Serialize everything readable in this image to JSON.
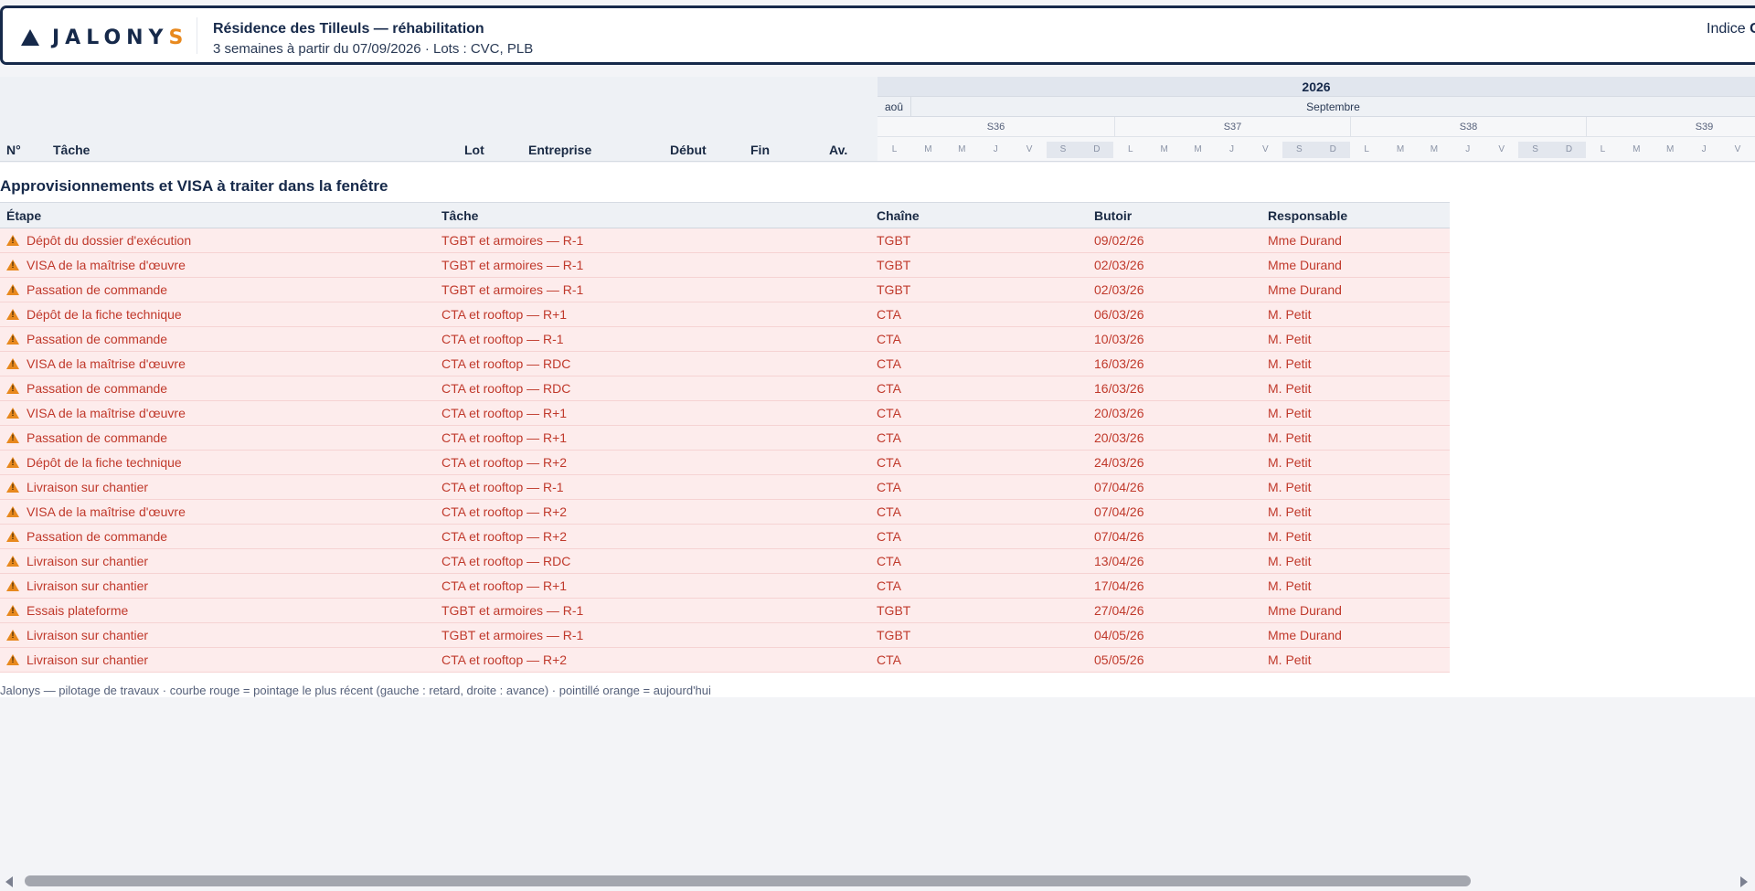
{
  "app": {
    "logo_main": "JALONY",
    "logo_accent": "S",
    "project_title": "Résidence des Tilleuls — réhabilitation",
    "project_subtitle": "3 semaines à partir du 07/09/2026 · Lots : CVC, PLB",
    "revision_label": "Indice",
    "revision_value": "C"
  },
  "colors": {
    "brand_navy": "#16294a",
    "brand_orange": "#e8891e",
    "alert_text": "#c0392b",
    "alert_row_bg": "#fdecec"
  },
  "grid": {
    "columns": [
      {
        "key": "num",
        "label": "N°"
      },
      {
        "key": "task",
        "label": "Tâche"
      },
      {
        "key": "lot",
        "label": "Lot"
      },
      {
        "key": "company",
        "label": "Entreprise"
      },
      {
        "key": "start",
        "label": "Début"
      },
      {
        "key": "end",
        "label": "Fin"
      },
      {
        "key": "progress",
        "label": "Av."
      }
    ]
  },
  "timeline": {
    "year": "2026",
    "months": [
      "aoû",
      "Septembre"
    ],
    "weeks": [
      "S36",
      "S37",
      "S38",
      "S39"
    ],
    "days": [
      "L",
      "M",
      "M",
      "J",
      "V",
      "S",
      "D",
      "L",
      "M",
      "M",
      "J",
      "V",
      "S",
      "D",
      "L",
      "M",
      "M",
      "J",
      "V",
      "S",
      "D",
      "L",
      "M",
      "M",
      "J",
      "V"
    ]
  },
  "procurement": {
    "title": "Approvisionnements et VISA à traiter dans la fenêtre",
    "columns": [
      "Étape",
      "Tâche",
      "Chaîne",
      "Butoir",
      "Responsable"
    ],
    "rows": [
      {
        "step": "Dépôt du dossier d'exécution",
        "task": "TGBT et armoires — R-1",
        "chain": "TGBT",
        "deadline": "09/02/26",
        "owner": "Mme Durand"
      },
      {
        "step": "VISA de la maîtrise d'œuvre",
        "task": "TGBT et armoires — R-1",
        "chain": "TGBT",
        "deadline": "02/03/26",
        "owner": "Mme Durand"
      },
      {
        "step": "Passation de commande",
        "task": "TGBT et armoires — R-1",
        "chain": "TGBT",
        "deadline": "02/03/26",
        "owner": "Mme Durand"
      },
      {
        "step": "Dépôt de la fiche technique",
        "task": "CTA et rooftop — R+1",
        "chain": "CTA",
        "deadline": "06/03/26",
        "owner": "M. Petit"
      },
      {
        "step": "Passation de commande",
        "task": "CTA et rooftop — R-1",
        "chain": "CTA",
        "deadline": "10/03/26",
        "owner": "M. Petit"
      },
      {
        "step": "VISA de la maîtrise d'œuvre",
        "task": "CTA et rooftop — RDC",
        "chain": "CTA",
        "deadline": "16/03/26",
        "owner": "M. Petit"
      },
      {
        "step": "Passation de commande",
        "task": "CTA et rooftop — RDC",
        "chain": "CTA",
        "deadline": "16/03/26",
        "owner": "M. Petit"
      },
      {
        "step": "VISA de la maîtrise d'œuvre",
        "task": "CTA et rooftop — R+1",
        "chain": "CTA",
        "deadline": "20/03/26",
        "owner": "M. Petit"
      },
      {
        "step": "Passation de commande",
        "task": "CTA et rooftop — R+1",
        "chain": "CTA",
        "deadline": "20/03/26",
        "owner": "M. Petit"
      },
      {
        "step": "Dépôt de la fiche technique",
        "task": "CTA et rooftop — R+2",
        "chain": "CTA",
        "deadline": "24/03/26",
        "owner": "M. Petit"
      },
      {
        "step": "Livraison sur chantier",
        "task": "CTA et rooftop — R-1",
        "chain": "CTA",
        "deadline": "07/04/26",
        "owner": "M. Petit"
      },
      {
        "step": "VISA de la maîtrise d'œuvre",
        "task": "CTA et rooftop — R+2",
        "chain": "CTA",
        "deadline": "07/04/26",
        "owner": "M. Petit"
      },
      {
        "step": "Passation de commande",
        "task": "CTA et rooftop — R+2",
        "chain": "CTA",
        "deadline": "07/04/26",
        "owner": "M. Petit"
      },
      {
        "step": "Livraison sur chantier",
        "task": "CTA et rooftop — RDC",
        "chain": "CTA",
        "deadline": "13/04/26",
        "owner": "M. Petit"
      },
      {
        "step": "Livraison sur chantier",
        "task": "CTA et rooftop — R+1",
        "chain": "CTA",
        "deadline": "17/04/26",
        "owner": "M. Petit"
      },
      {
        "step": "Essais plateforme",
        "task": "TGBT et armoires — R-1",
        "chain": "TGBT",
        "deadline": "27/04/26",
        "owner": "Mme Durand"
      },
      {
        "step": "Livraison sur chantier",
        "task": "TGBT et armoires — R-1",
        "chain": "TGBT",
        "deadline": "04/05/26",
        "owner": "Mme Durand"
      },
      {
        "step": "Livraison sur chantier",
        "task": "CTA et rooftop — R+2",
        "chain": "CTA",
        "deadline": "05/05/26",
        "owner": "M. Petit"
      }
    ]
  },
  "footer": {
    "note": "Jalonys — pilotage de travaux · courbe rouge = pointage le plus récent (gauche : retard, droite : avance) · pointillé orange = aujourd'hui"
  }
}
